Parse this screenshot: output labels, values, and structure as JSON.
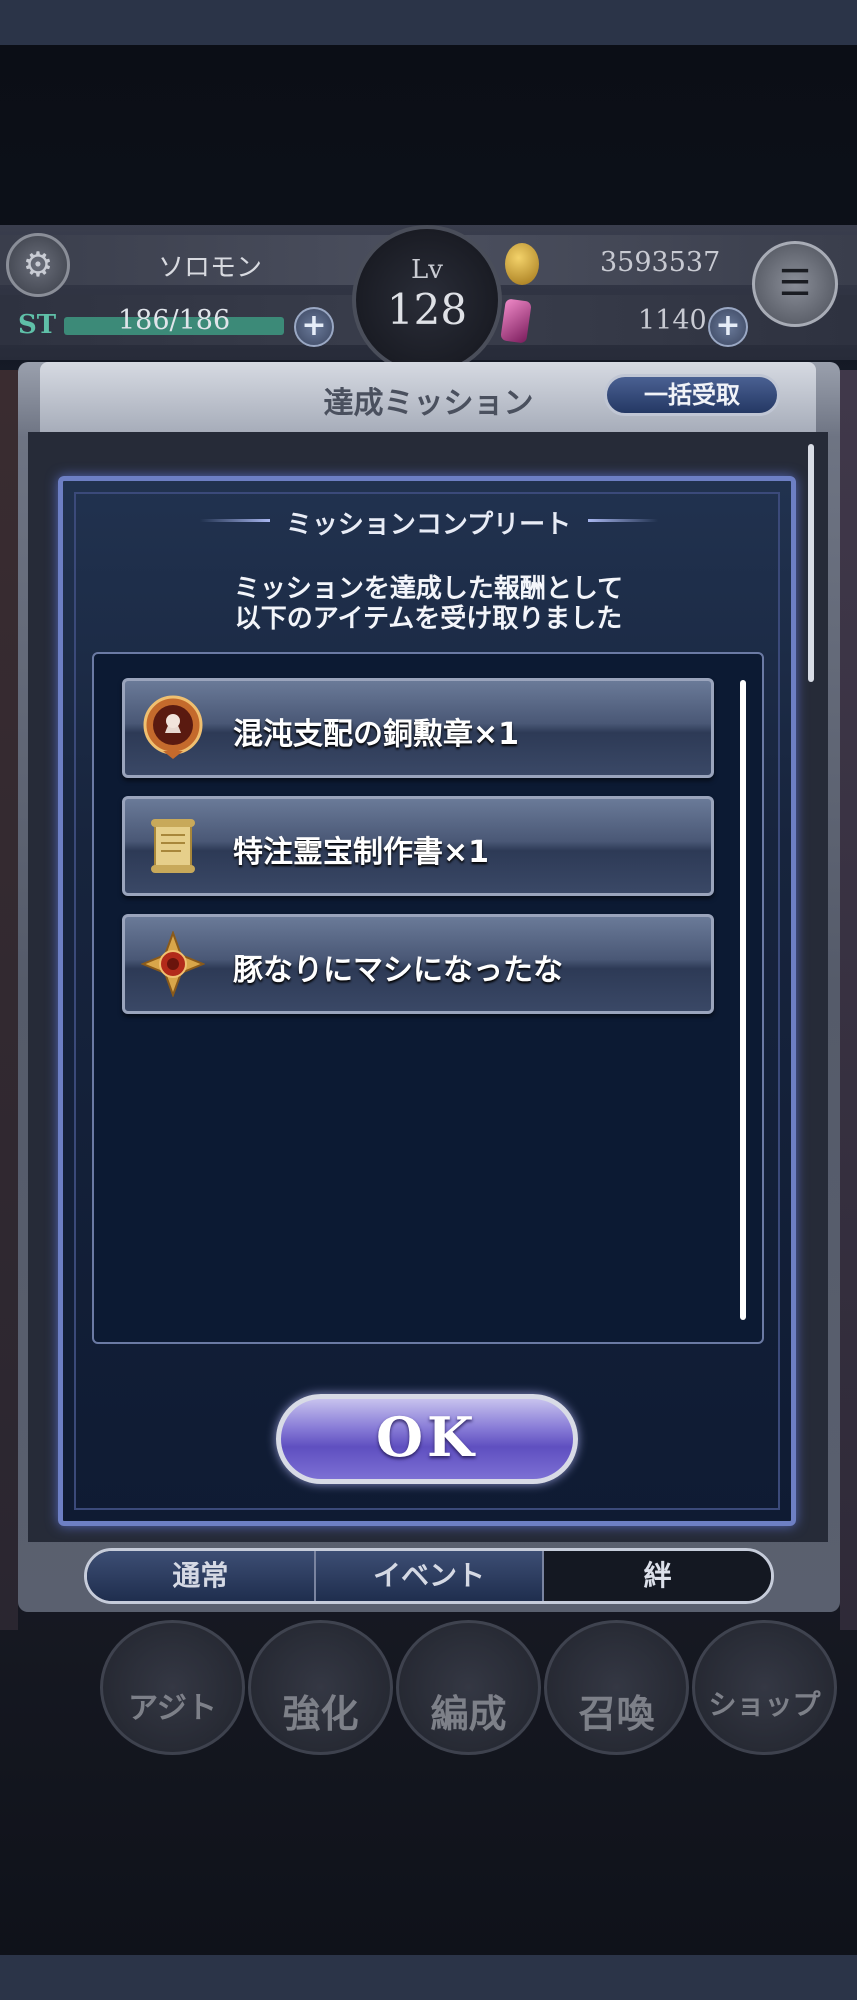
{
  "status": {
    "player_name": "ソロモン",
    "st_label": "ST",
    "st_value": "186/186",
    "level_label": "Lv",
    "level": "128",
    "money": "3593537",
    "gems": "1140"
  },
  "window": {
    "title": "達成ミッション",
    "bulk_receive_label": "一括受取"
  },
  "dialog": {
    "title": "ミッションコンプリート",
    "message_line1": "ミッションを達成した報酬として",
    "message_line2": "以下のアイテムを受け取りました",
    "items": [
      {
        "label": "混沌支配の銅勲章×1",
        "icon": "medal-icon"
      },
      {
        "label": "特注霊宝制作書×1",
        "icon": "scroll-icon"
      },
      {
        "label": "豚なりにマシになったな",
        "icon": "title-emblem-icon"
      }
    ],
    "ok_label": "OK"
  },
  "tabs": [
    {
      "label": "通常",
      "active": false
    },
    {
      "label": "イベント",
      "active": false
    },
    {
      "label": "絆",
      "active": true
    }
  ],
  "nav": [
    {
      "label": "アジト"
    },
    {
      "label": "強化"
    },
    {
      "label": "編成"
    },
    {
      "label": "召喚"
    },
    {
      "label": "ショップ"
    }
  ],
  "colors": {
    "dialog_border": "#6d7fc4",
    "ok_button": "#7c70d4",
    "tab_active": "#141822"
  }
}
